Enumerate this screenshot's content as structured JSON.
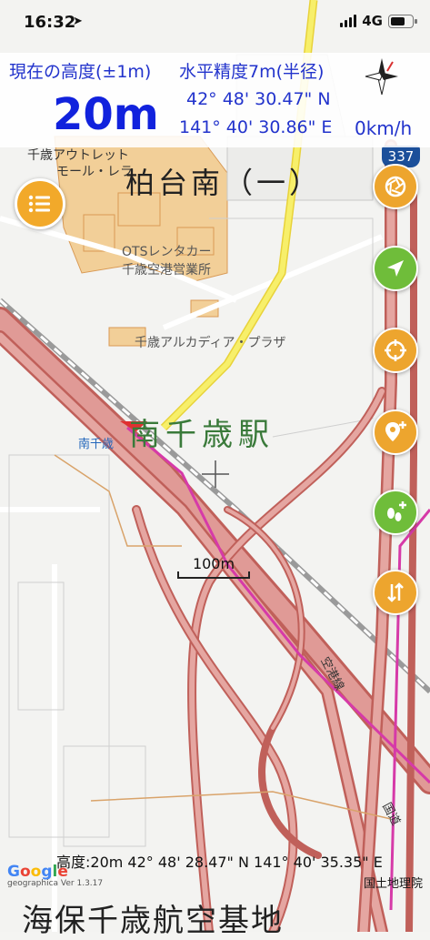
{
  "status_bar": {
    "time": "16:32",
    "network": "4G",
    "icons": [
      "location-arrow-icon",
      "signal-icon",
      "battery-icon"
    ]
  },
  "info_panel": {
    "altitude_label": "現在の高度(±1m)",
    "altitude_value": "20m",
    "accuracy_label": "水平精度7m(半径)",
    "latitude": "42° 48' 30.47\" N",
    "longitude": "141° 40' 30.86\" E",
    "speed": "0km/h"
  },
  "map": {
    "labels": {
      "area": "柏台南（一）",
      "outlet": "千歳アウトレット",
      "outlet2": "モール・レラ",
      "ots": "OTSレンタカー",
      "ots2": "千歳空港営業所",
      "arcadia": "千歳アルカディア・プラザ",
      "station": "南千歳駅",
      "station_small": "南千歳",
      "route_line": "空港線",
      "kokudo": "国道",
      "base": "海保千歳航空基地",
      "route_shield": "337"
    },
    "scale_label": "100m",
    "colors": {
      "highway": "#d98080",
      "highway_edge": "#c0605a",
      "yellow_road": "#f2e84a",
      "magenta_route": "#d63aa8",
      "building": "#f0c88a",
      "building_edge": "#d99a55"
    }
  },
  "footer": {
    "center_coord": "高度:20m  42° 48' 28.47\" N  141° 40' 35.35\" E",
    "google": [
      "G",
      "o",
      "o",
      "g",
      "l",
      "e"
    ],
    "version": "geographica Ver 1.3.17",
    "attribution": "国土地理院"
  },
  "buttons": {
    "menu": "menu-list-icon",
    "side": [
      "aperture-icon",
      "navigation-arrow-icon",
      "crosshair-icon",
      "add-location-pin-icon",
      "add-footprint-icon",
      "swap-icon"
    ]
  }
}
